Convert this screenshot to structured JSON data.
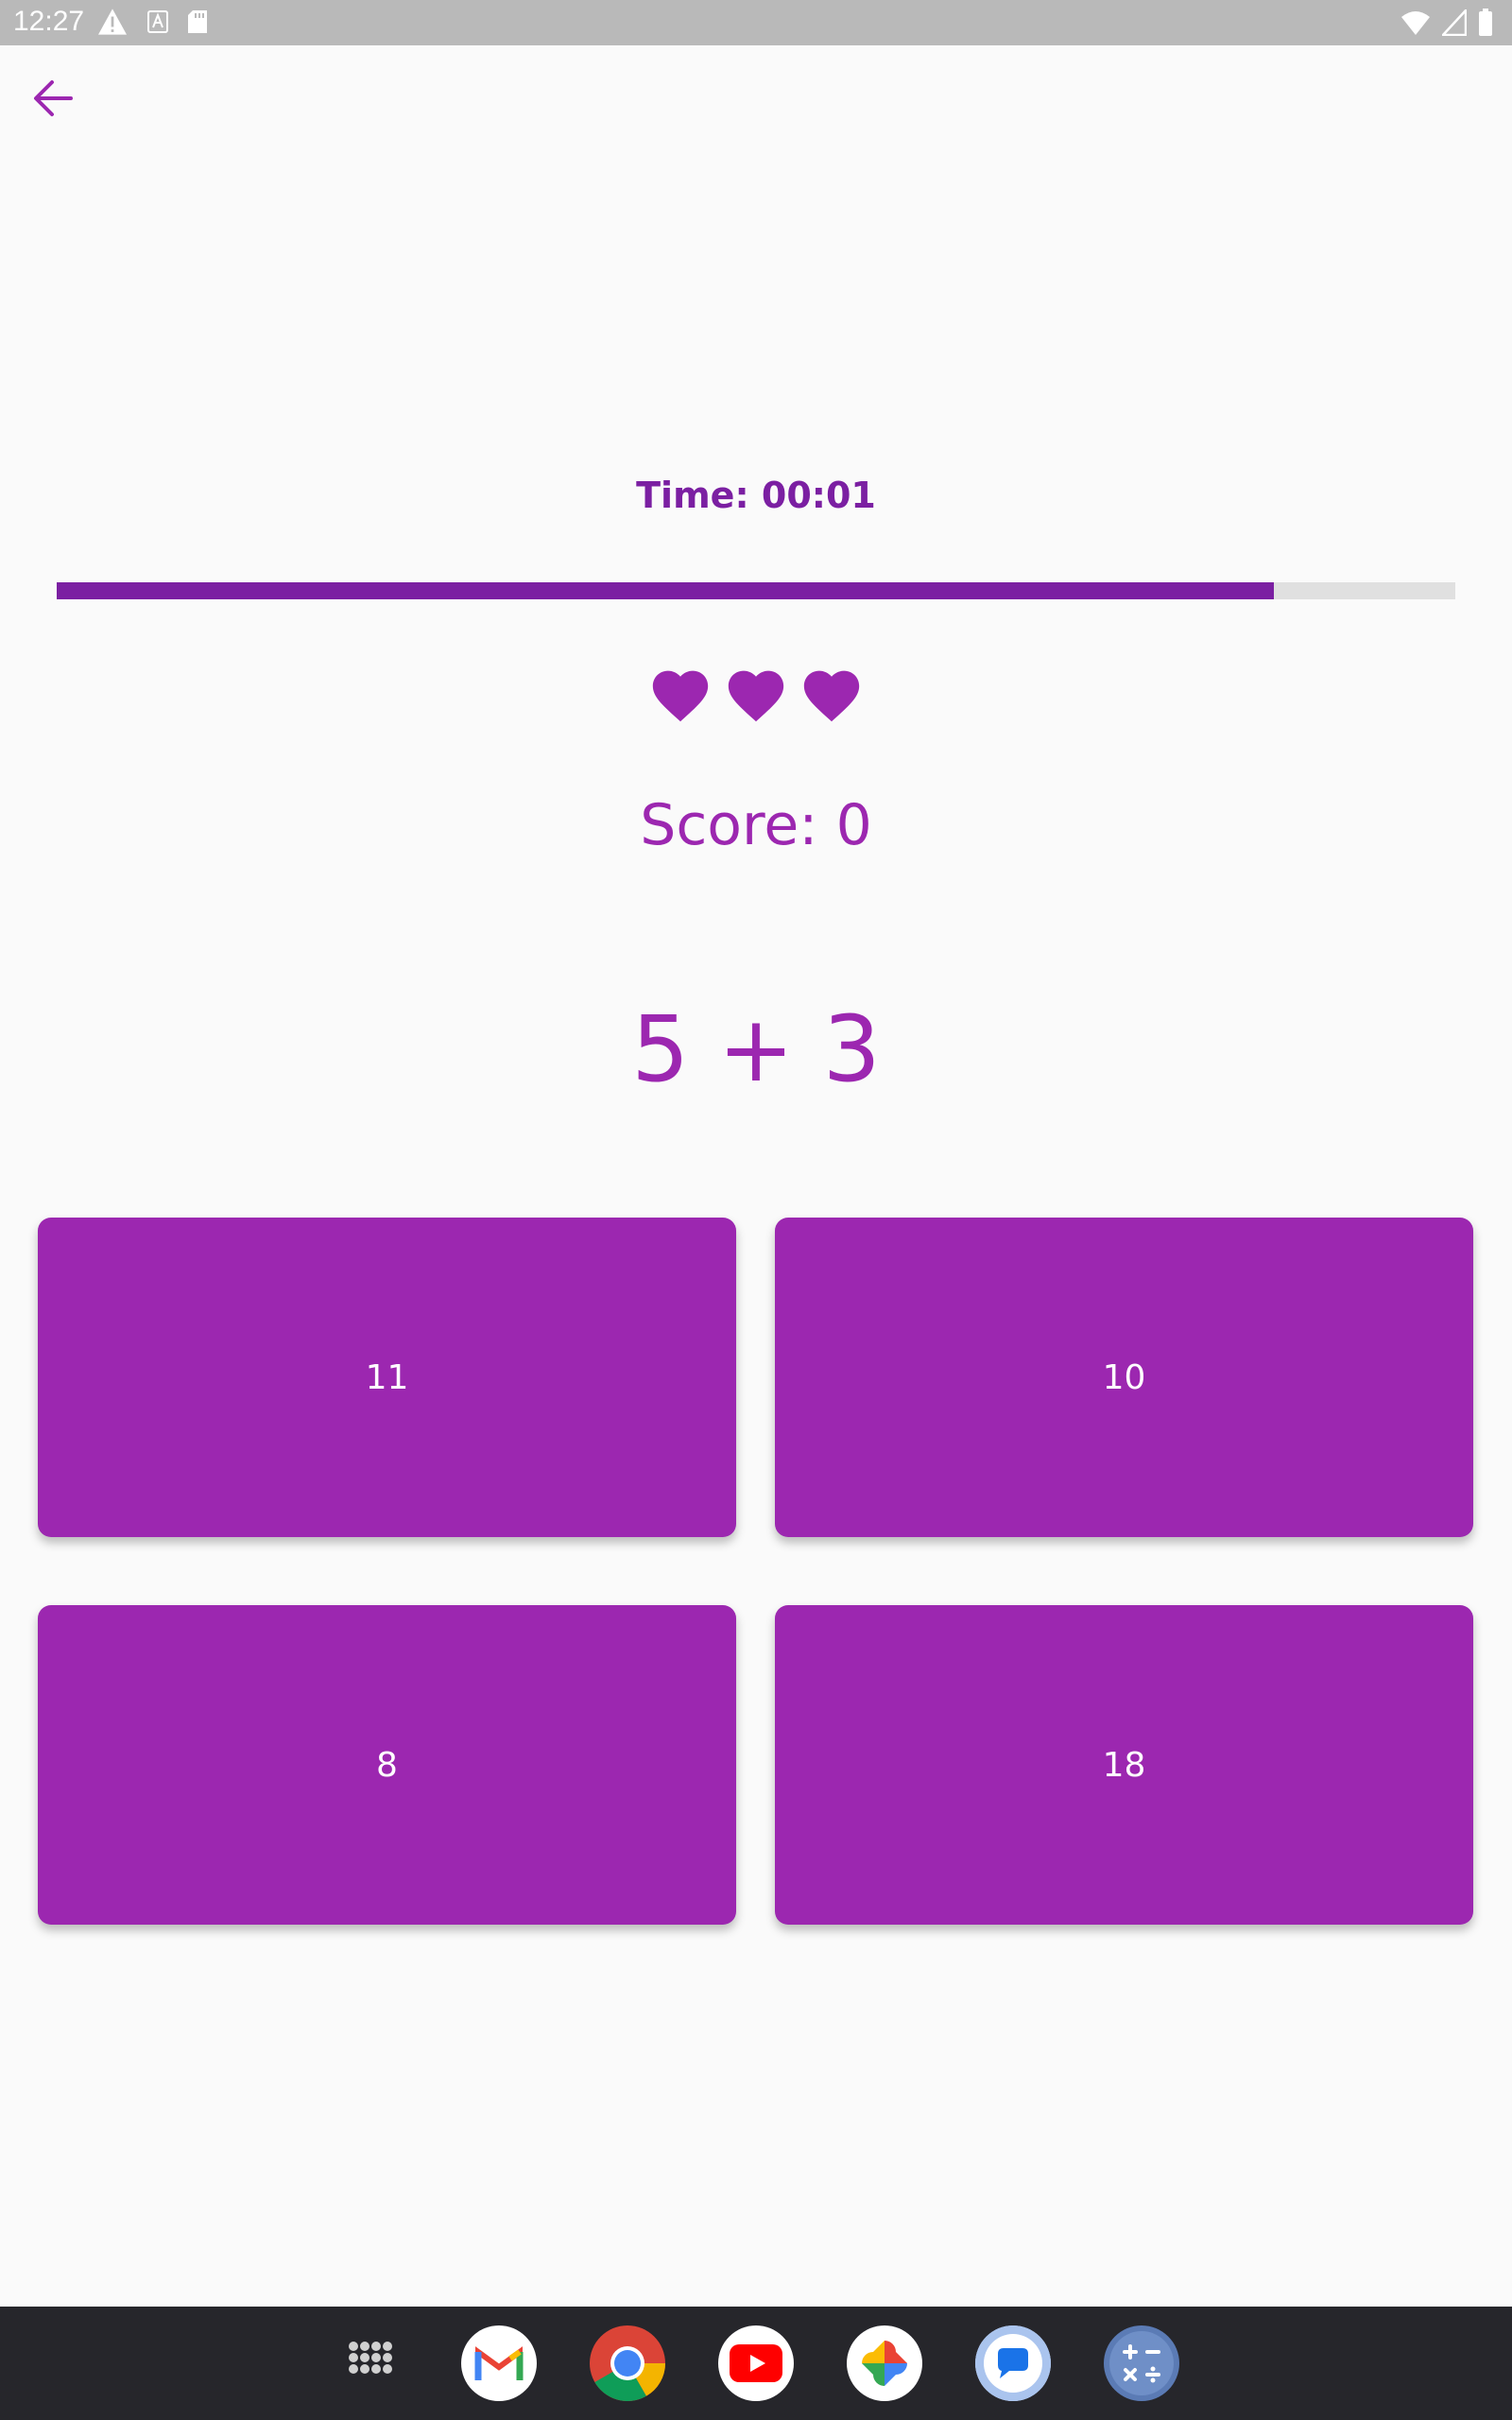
{
  "status_bar": {
    "time": "12:27",
    "left_icons": [
      "warning-icon",
      "text-a-icon",
      "sd-card-icon"
    ],
    "right_icons": [
      "wifi-icon",
      "cell-signal-icon",
      "battery-icon"
    ]
  },
  "header": {
    "back_icon": "arrow-back-icon"
  },
  "game": {
    "timer_text": "Time: 00:01",
    "progress_fraction": 0.87,
    "lives": 3,
    "score_text": "Score: 0",
    "question": "5 + 3",
    "answers": [
      "11",
      "10",
      "8",
      "18"
    ]
  },
  "colors": {
    "accent": "#9c27b0",
    "accent_dark": "#7b1fa2",
    "progress_track": "#e0e0e0",
    "background": "#fafafa",
    "taskbar": "#26262b"
  },
  "taskbar": {
    "apps": [
      "app-drawer-icon",
      "gmail-icon",
      "chrome-icon",
      "youtube-icon",
      "photos-icon",
      "messages-icon",
      "calculator-icon"
    ]
  }
}
